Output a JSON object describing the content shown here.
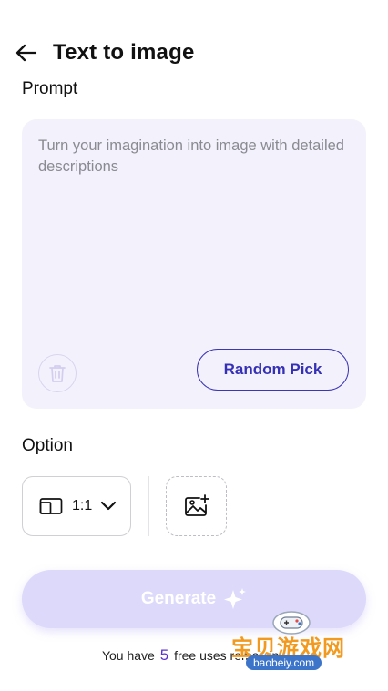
{
  "header": {
    "title": "Text to image",
    "back_icon": "arrow-left-icon"
  },
  "prompt": {
    "label": "Prompt",
    "value": "",
    "placeholder": "Turn your imagination into image with detailed descriptions",
    "clear_icon": "trash-icon",
    "random_label": "Random Pick"
  },
  "option": {
    "label": "Option",
    "ratio_icon": "aspect-ratio-icon",
    "ratio_value": "1:1",
    "ratio_chevron": "chevron-down-icon",
    "image_icon": "add-image-icon"
  },
  "generate": {
    "label": "Generate",
    "icon": "sparkle-icon"
  },
  "footer": {
    "prefix": "You have",
    "count": "5",
    "suffix": "free uses remaining"
  },
  "watermark": {
    "text": "宝贝游戏网",
    "sub": "baobeiy.com"
  },
  "colors": {
    "accent": "#3530b5",
    "prompt_bg": "#f3f2fc",
    "generate_bg": "#dcd9fb",
    "count": "#5b2fd0",
    "watermark_orange": "#f29a1f",
    "watermark_blue": "#3c74c9"
  }
}
